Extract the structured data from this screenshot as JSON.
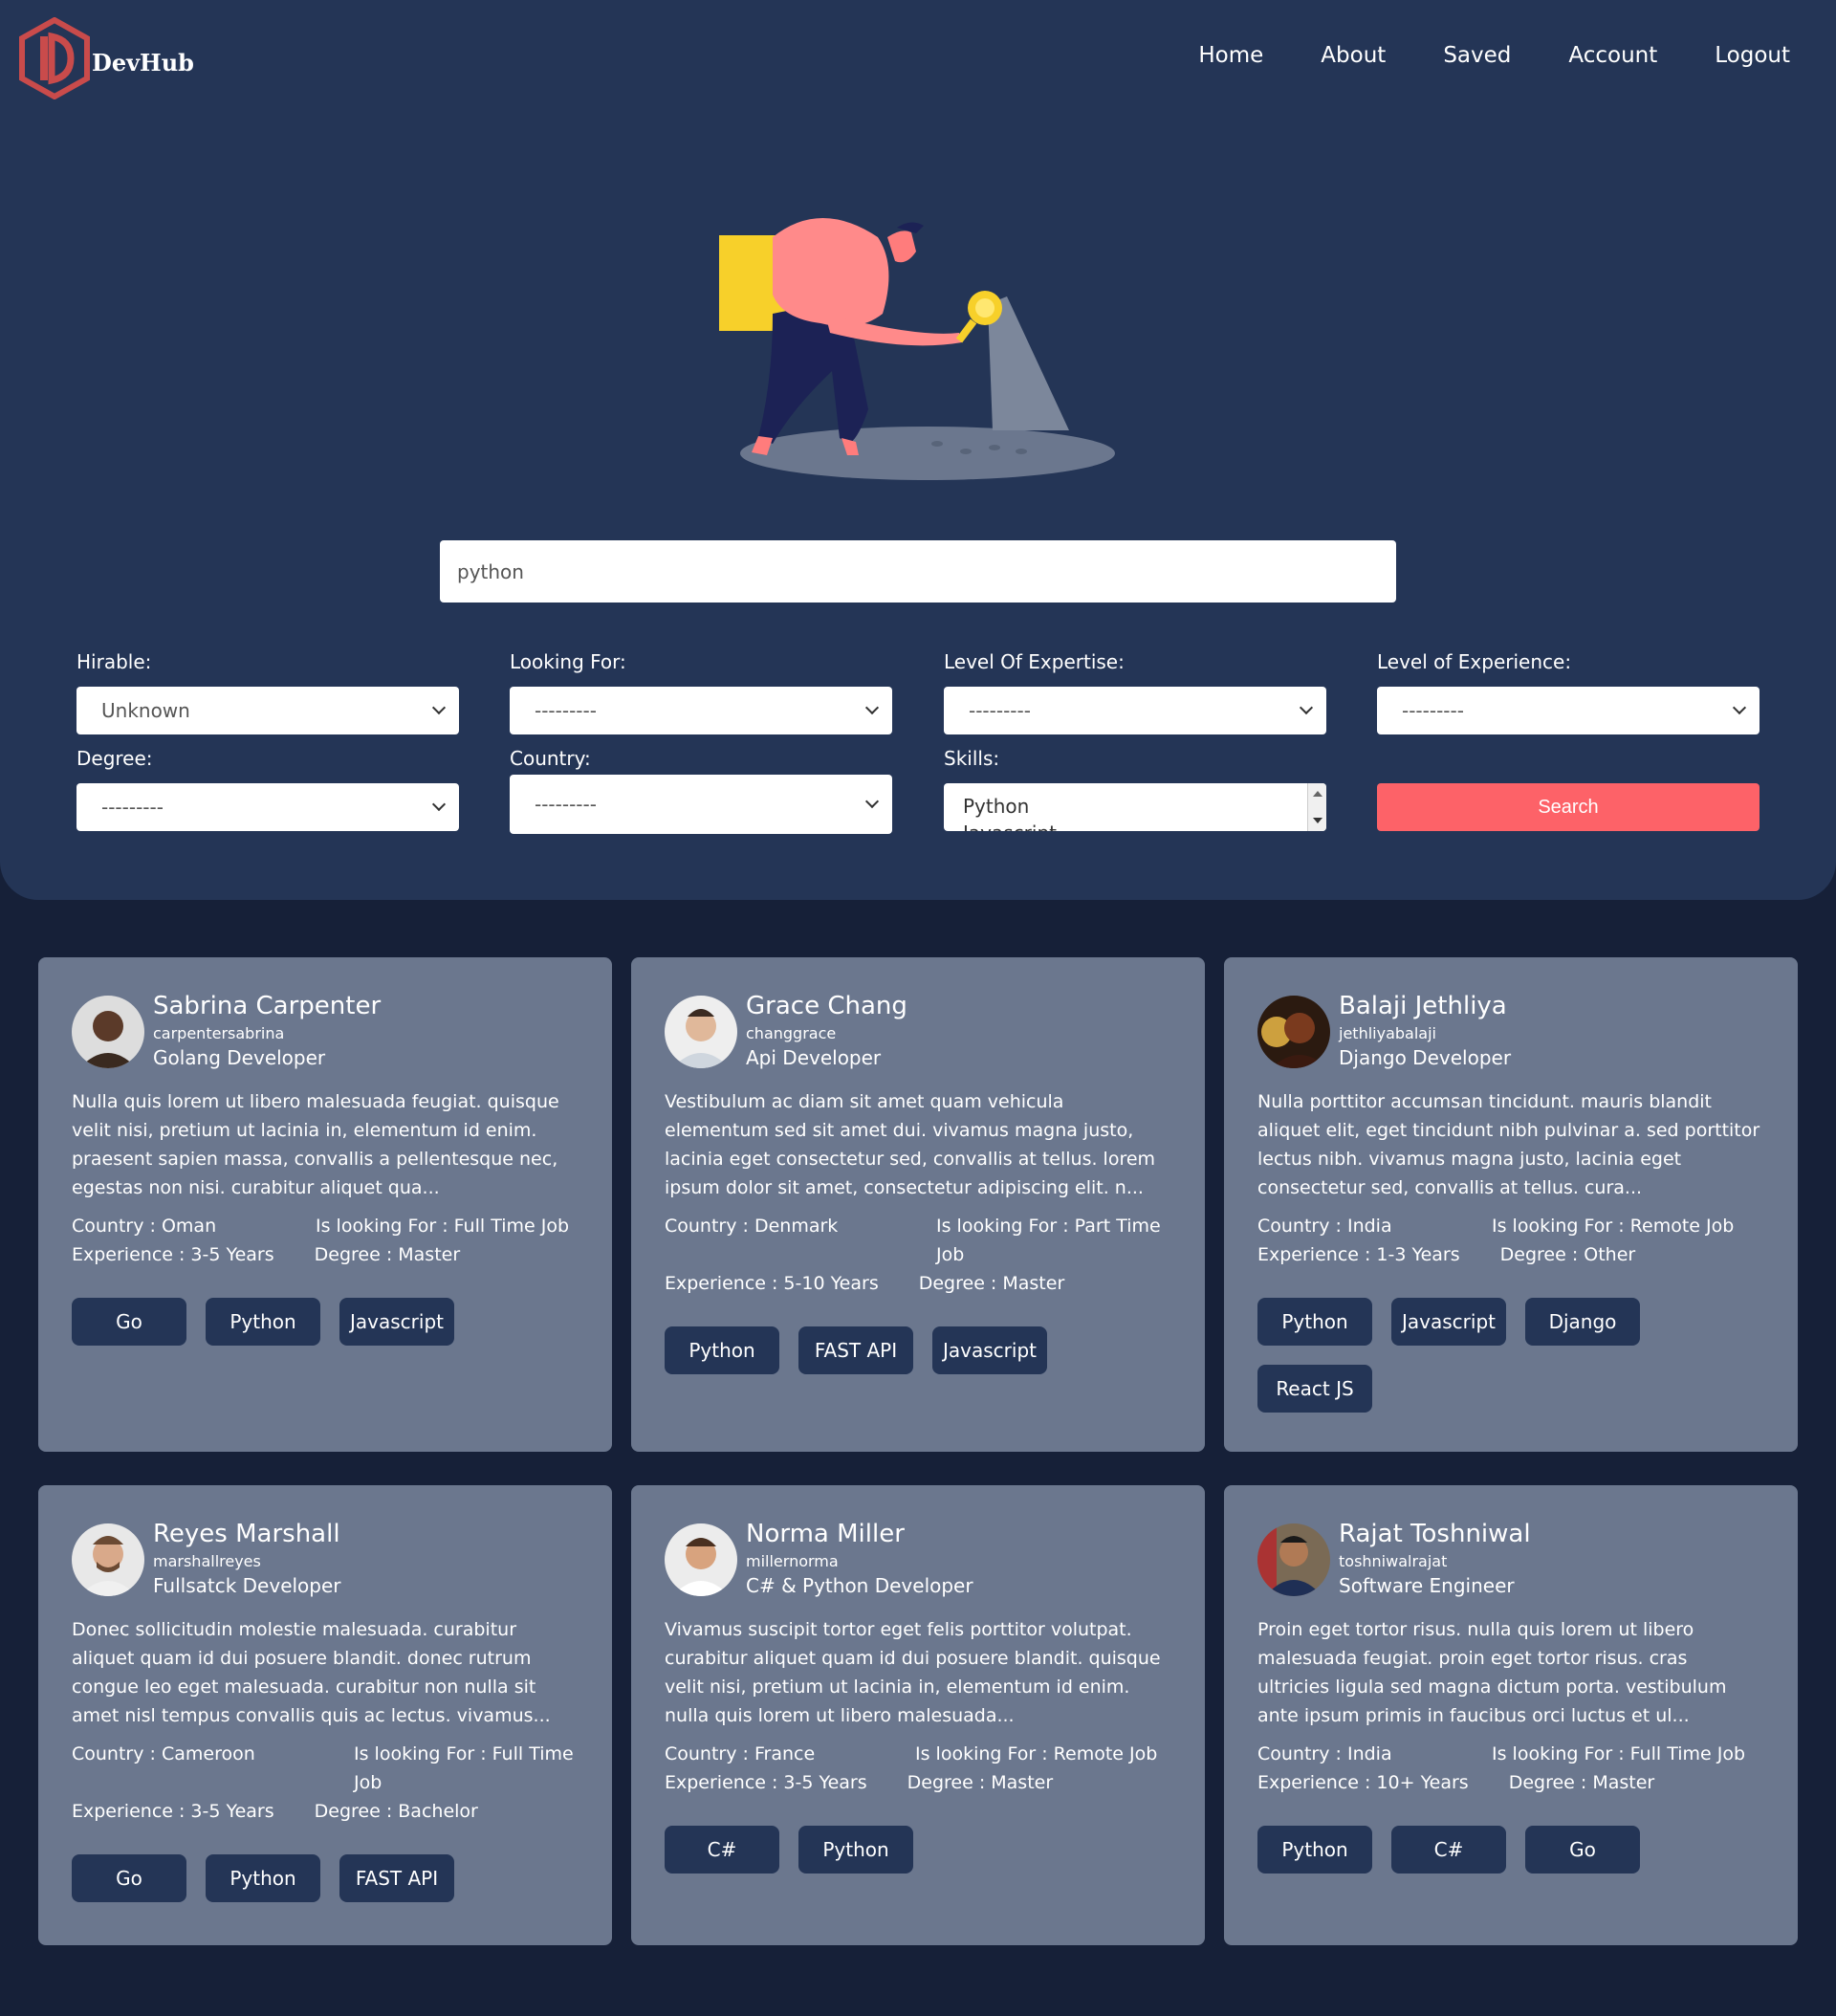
{
  "header": {
    "logo_text": "DevHub",
    "nav": [
      "Home",
      "About",
      "Saved",
      "Account",
      "Logout"
    ]
  },
  "search": {
    "value": "python"
  },
  "filters": {
    "hirable": {
      "label": "Hirable:",
      "value": "Unknown"
    },
    "looking_for": {
      "label": "Looking For:",
      "value": "---------"
    },
    "expertise": {
      "label": "Level Of Expertise:",
      "value": "---------"
    },
    "experience": {
      "label": "Level of Experience:",
      "value": "---------"
    },
    "degree": {
      "label": "Degree:",
      "value": "---------"
    },
    "country": {
      "label": "Country:",
      "value": "---------"
    },
    "skills": {
      "label": "Skills:",
      "option1": "Python",
      "option2": "Javascript"
    },
    "search_button": "Search"
  },
  "colors": {
    "accent": "#fd6268",
    "hero_bg": "#243556",
    "page_bg": "#162038",
    "card_bg": "#6b778e"
  },
  "cards": [
    {
      "name": "Sabrina Carpenter",
      "username": "carpentersabrina",
      "role": "Golang Developer",
      "bio": "Nulla quis lorem ut libero malesuada feugiat. quisque velit nisi, pretium ut lacinia in, elementum id enim. praesent sapien massa, convallis a pellentesque nec, egestas non nisi. curabitur aliquet qua...",
      "country": "Country : Oman",
      "looking": "Is looking For : Full Time Job",
      "experience": "Experience : 3-5 Years",
      "degree": "Degree : Master",
      "tags": [
        "Go",
        "Python",
        "Javascript"
      ]
    },
    {
      "name": "Grace Chang",
      "username": "changgrace",
      "role": "Api Developer",
      "bio": "Vestibulum ac diam sit amet quam vehicula elementum sed sit amet dui. vivamus magna justo, lacinia eget consectetur sed, convallis at tellus. lorem ipsum dolor sit amet, consectetur adipiscing elit. n...",
      "country": "Country : Denmark",
      "looking": "Is looking For : Part Time Job",
      "experience": "Experience : 5-10 Years",
      "degree": "Degree : Master",
      "tags": [
        "Python",
        "FAST API",
        "Javascript"
      ]
    },
    {
      "name": "Balaji Jethliya",
      "username": "jethliyabalaji",
      "role": "Django Developer",
      "bio": "Nulla porttitor accumsan tincidunt. mauris blandit aliquet elit, eget tincidunt nibh pulvinar a. sed porttitor lectus nibh. vivamus magna justo, lacinia eget consectetur sed, convallis at tellus. cura...",
      "country": "Country : India",
      "looking": "Is looking For : Remote Job",
      "experience": "Experience : 1-3 Years",
      "degree": "Degree : Other",
      "tags": [
        "Python",
        "Javascript",
        "Django",
        "React JS"
      ]
    },
    {
      "name": "Reyes Marshall",
      "username": "marshallreyes",
      "role": "Fullsatck Developer",
      "bio": "Donec sollicitudin molestie malesuada. curabitur aliquet quam id dui posuere blandit. donec rutrum congue leo eget malesuada. curabitur non nulla sit amet nisl tempus convallis quis ac lectus. vivamus...",
      "country": "Country : Cameroon",
      "looking": "Is looking For : Full Time Job",
      "experience": "Experience : 3-5 Years",
      "degree": "Degree : Bachelor",
      "tags": [
        "Go",
        "Python",
        "FAST API"
      ]
    },
    {
      "name": "Norma Miller",
      "username": "millernorma",
      "role": "C# & Python Developer",
      "bio": "Vivamus suscipit tortor eget felis porttitor volutpat. curabitur aliquet quam id dui posuere blandit. quisque velit nisi, pretium ut lacinia in, elementum id enim. nulla quis lorem ut libero malesuada...",
      "country": "Country : France",
      "looking": "Is looking For : Remote Job",
      "experience": "Experience : 3-5 Years",
      "degree": "Degree : Master",
      "tags": [
        "C#",
        "Python"
      ]
    },
    {
      "name": "Rajat Toshniwal",
      "username": "toshniwalrajat",
      "role": "Software Engineer",
      "bio": "Proin eget tortor risus. nulla quis lorem ut libero malesuada feugiat. proin eget tortor risus. cras ultricies ligula sed magna dictum porta. vestibulum ante ipsum primis in faucibus orci luctus et ul...",
      "country": "Country : India",
      "looking": "Is looking For : Full Time Job",
      "experience": "Experience : 10+ Years",
      "degree": "Degree : Master",
      "tags": [
        "Python",
        "C#",
        "Go"
      ]
    }
  ]
}
